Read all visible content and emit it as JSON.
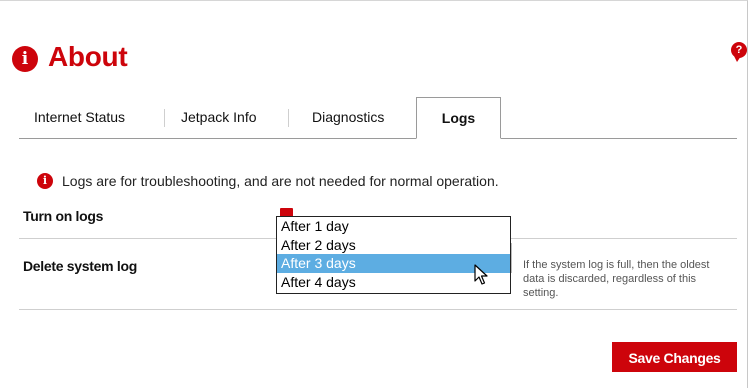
{
  "page": {
    "title": "About",
    "title_icon": "info-icon",
    "help_icon": "help-chat-icon",
    "accent_color": "#cd040b"
  },
  "tabs": [
    {
      "label": "Internet Status",
      "active": false
    },
    {
      "label": "Jetpack Info",
      "active": false
    },
    {
      "label": "Diagnostics",
      "active": false
    },
    {
      "label": "Logs",
      "active": true
    }
  ],
  "info": {
    "icon": "info-icon",
    "text": "Logs are for troubleshooting, and are not needed for normal operation."
  },
  "settings": {
    "turn_on_logs": {
      "label": "Turn on logs",
      "checked": true
    },
    "delete_system_log": {
      "label": "Delete system log",
      "options": [
        "After 1 day",
        "After 2 days",
        "After 3 days",
        "After 4 days"
      ],
      "highlighted_option": "After 3 days",
      "help_text": "If the system log is full, then the oldest data is discarded, regardless of this setting."
    }
  },
  "actions": {
    "save_label": "Save Changes"
  }
}
